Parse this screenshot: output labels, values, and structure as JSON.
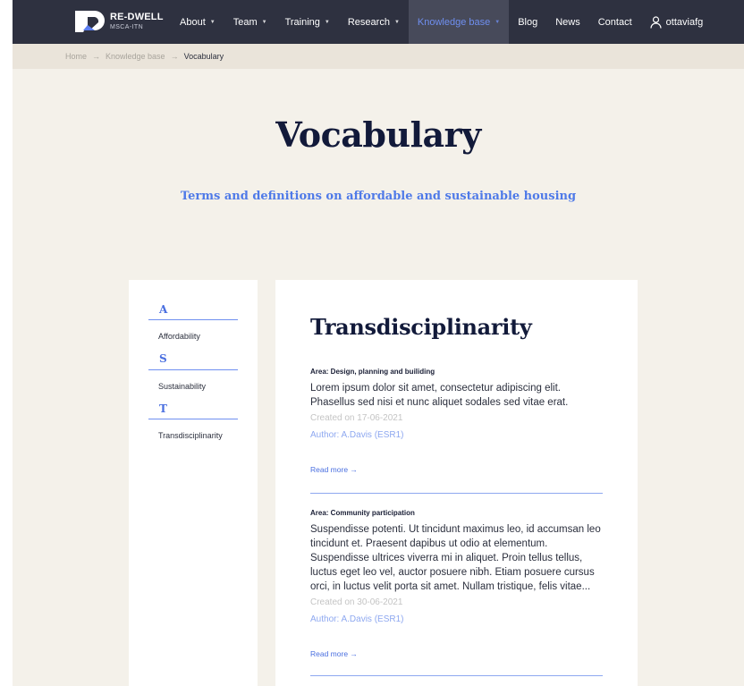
{
  "nav": {
    "logo_title": "RE-DWELL",
    "logo_sub": "MSCA-ITN",
    "items": [
      {
        "label": "About",
        "dropdown": true
      },
      {
        "label": "Team",
        "dropdown": true
      },
      {
        "label": "Training",
        "dropdown": true
      },
      {
        "label": "Research",
        "dropdown": true
      },
      {
        "label": "Knowledge base",
        "dropdown": true,
        "active": true
      },
      {
        "label": "Blog",
        "dropdown": false
      },
      {
        "label": "News",
        "dropdown": false
      },
      {
        "label": "Contact",
        "dropdown": false
      }
    ],
    "caret": "▼",
    "user": "ottaviafg"
  },
  "breadcrumb": {
    "home": "Home",
    "sep": "→",
    "section": "Knowledge base",
    "current": "Vocabulary"
  },
  "page": {
    "title": "Vocabulary",
    "subtitle": "Terms and definitions on affordable and sustainable housing"
  },
  "sidebar": {
    "groups": [
      {
        "letter": "A",
        "terms": [
          "Affordability"
        ]
      },
      {
        "letter": "S",
        "terms": [
          "Sustainability"
        ]
      },
      {
        "letter": "T",
        "terms": [
          "Transdisciplinarity"
        ]
      }
    ]
  },
  "content": {
    "title": "Transdisciplinarity",
    "entries": [
      {
        "area": "Area: Design, planning and builiding",
        "description": "Lorem ipsum dolor sit amet, consectetur adipiscing elit. Phasellus sed nisi et nunc aliquet sodales sed vitae erat.",
        "created": "Created on 17-06-2021",
        "author": "Author: A.Davis (ESR1)",
        "read_more": "Read more →"
      },
      {
        "area": "Area: Community participation",
        "description": "Suspendisse potenti. Ut tincidunt maximus leo, id accumsan leo tincidunt et. Praesent dapibus ut odio at elementum. Suspendisse ultrices viverra mi in aliquet. Proin tellus tellus, luctus eget leo vel, auctor posuere nibh. Etiam posuere cursus orci, in luctus velit porta sit amet. Nullam tristique, felis vitae...",
        "created": "Created on 30-06-2021",
        "author": "Author: A.Davis (ESR1)",
        "read_more": "Read more →"
      }
    ]
  },
  "colors": {
    "navbar": "#2e3140",
    "accent": "#4f7ae8",
    "background": "#f4f1ea",
    "breadcrumb_bg": "#eae4da"
  }
}
